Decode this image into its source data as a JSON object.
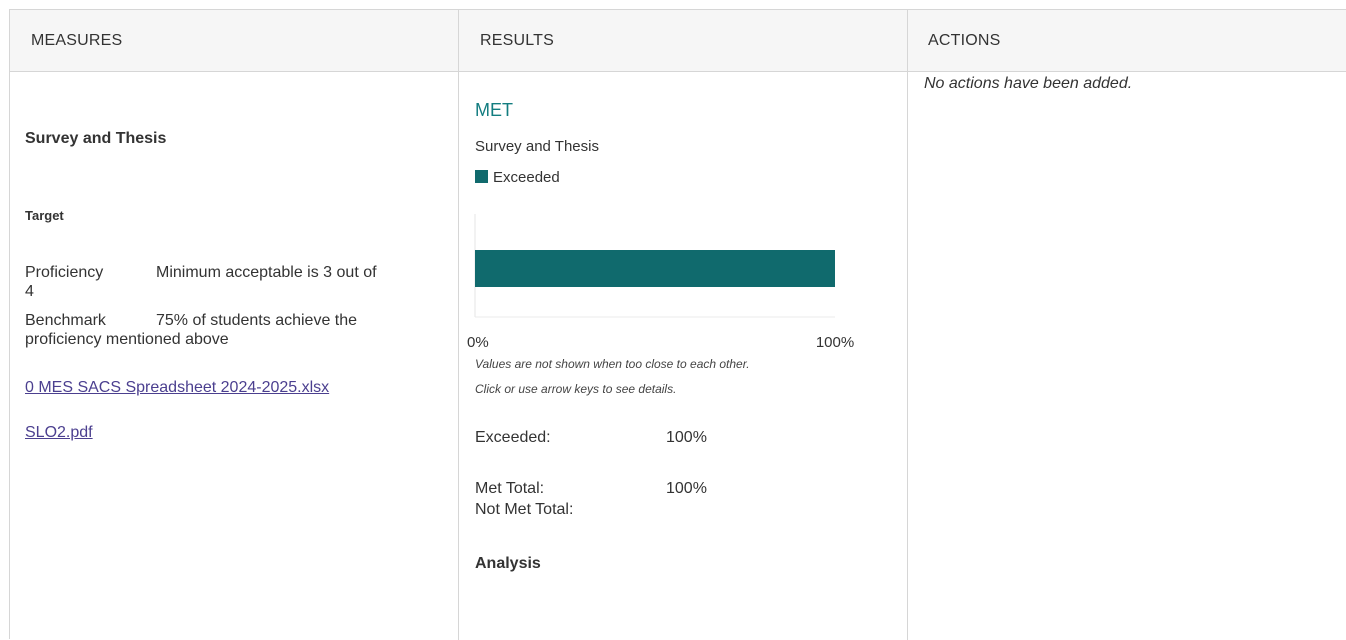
{
  "headers": {
    "measures": "MEASURES",
    "results": "RESULTS",
    "actions": "ACTIONS"
  },
  "measures": {
    "title": "Survey and Thesis",
    "target_label": "Target",
    "proficiency_label": "Proficiency",
    "proficiency_value": "Minimum acceptable is 3 out of",
    "proficiency_value_cont": "4",
    "benchmark_label": "Benchmark",
    "benchmark_value": "75% of students achieve the",
    "benchmark_value_cont": "proficiency mentioned above",
    "attachments": [
      "0 MES SACS Spreadsheet 2024-2025.xlsx",
      "SLO2.pdf"
    ]
  },
  "results": {
    "status": "MET",
    "measure_name": "Survey and Thesis",
    "legend_label": "Exceeded",
    "chart_note_1": "Values are not shown when too close to each other.",
    "chart_note_2": "Click or use arrow keys to see details.",
    "exceeded_label": "Exceeded:",
    "exceeded_value": "100%",
    "met_total_label": "Met Total:",
    "met_total_value": "100%",
    "not_met_total_label": "Not Met Total:",
    "analysis_label": "Analysis"
  },
  "chart_data": {
    "type": "bar",
    "orientation": "horizontal",
    "categories": [
      "Survey and Thesis"
    ],
    "series": [
      {
        "name": "Exceeded",
        "values": [
          100
        ]
      }
    ],
    "xlim": [
      0,
      100
    ],
    "tick_labels": [
      "0%",
      "100%"
    ],
    "color": "#106a6d"
  },
  "actions": {
    "empty_text": "No actions have been added."
  },
  "colors": {
    "accent": "#137d80",
    "bar": "#106a6d",
    "link": "#4b3f8f",
    "header_bg": "#f6f6f6",
    "border": "#d6d6d6"
  }
}
